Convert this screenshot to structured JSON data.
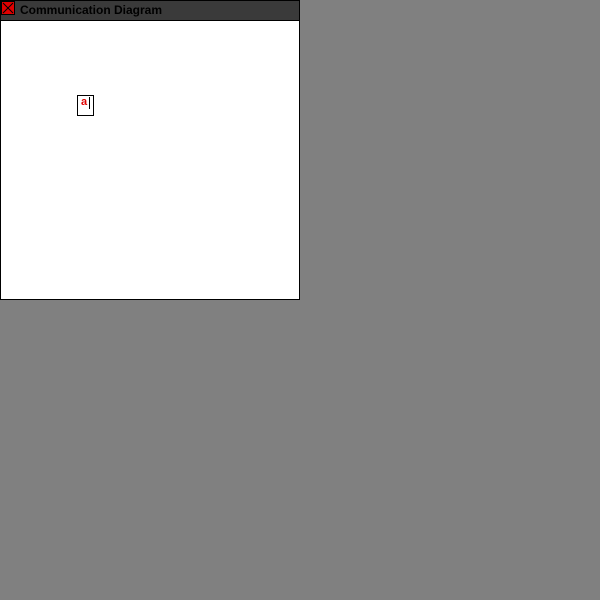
{
  "window": {
    "title": "Communication Diagram",
    "close_icon": "close-x-icon"
  },
  "diagram": {
    "node": {
      "label": "a",
      "editing": true
    }
  },
  "colors": {
    "desktop": "#808080",
    "titlebar": "#3a3a3a",
    "close_button": "#e00000",
    "node_label": "#e00000",
    "canvas": "#ffffff"
  }
}
